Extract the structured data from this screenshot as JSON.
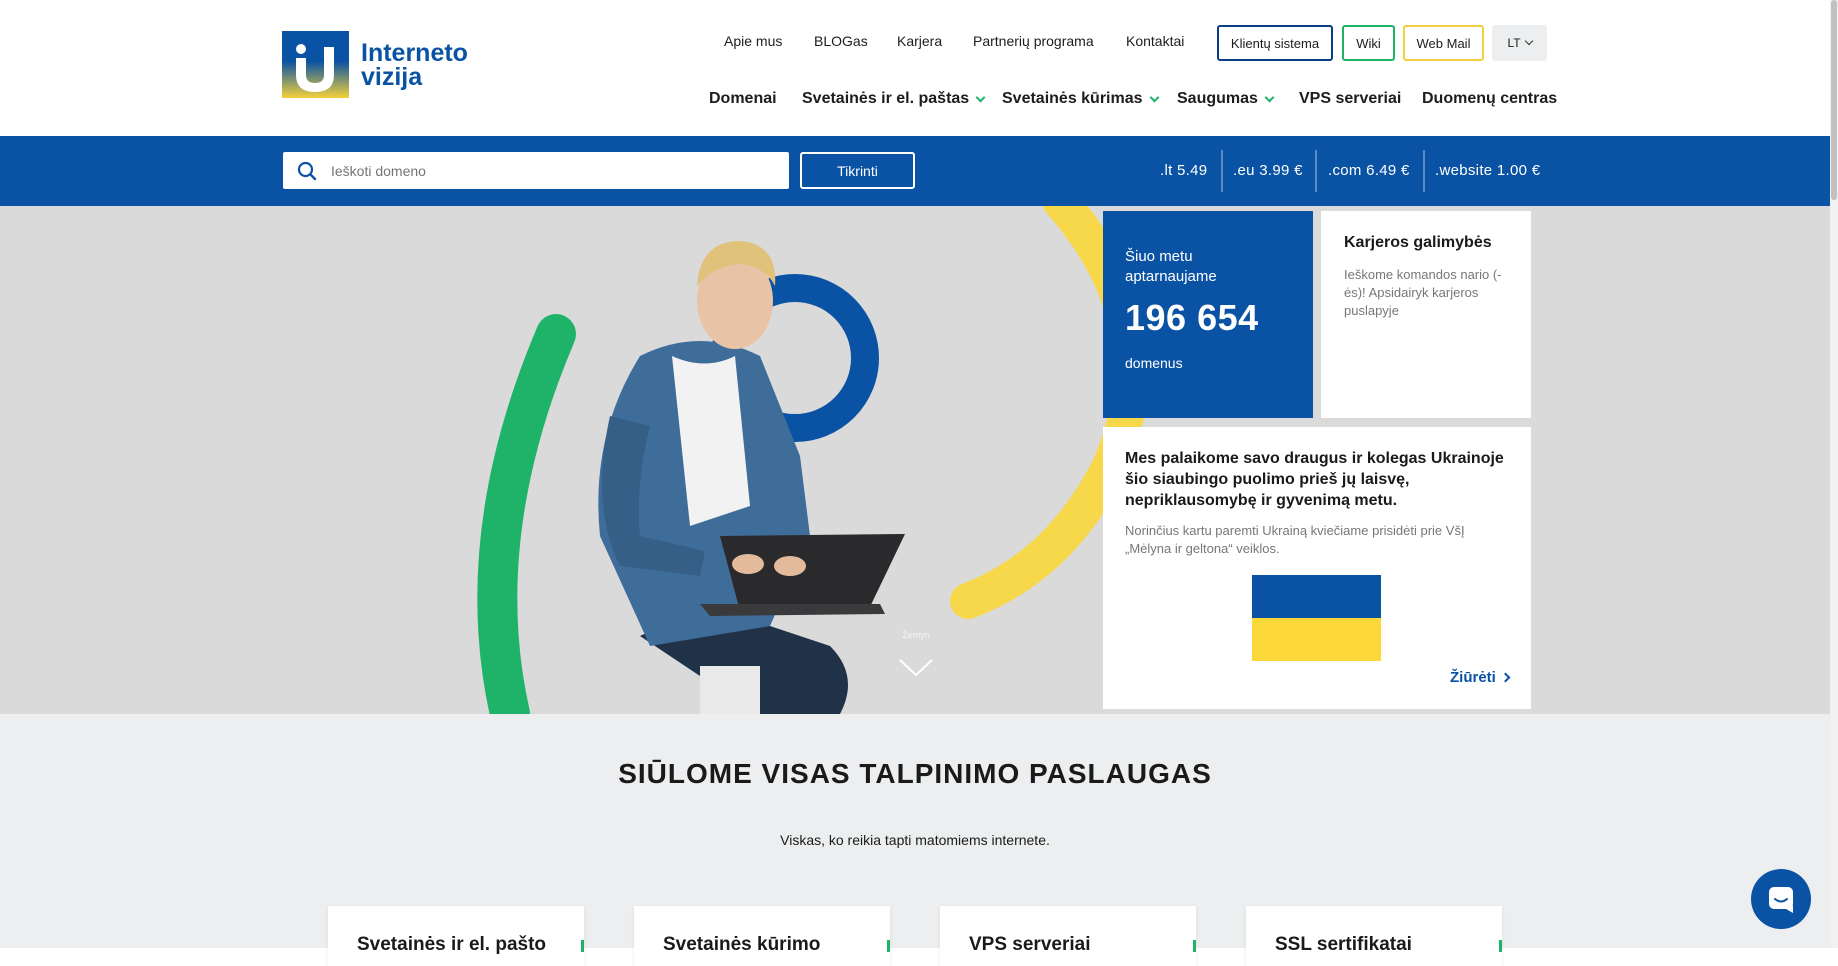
{
  "logo": {
    "line1": "Interneto",
    "line2": "vizija"
  },
  "top_nav": [
    "Apie mus",
    "BLOGas",
    "Karjera",
    "Partnerių programa",
    "Kontaktai"
  ],
  "top_buttons": {
    "clients": "Klientų sistema",
    "wiki": "Wiki",
    "webmail": "Web Mail",
    "lang": "LT"
  },
  "main_nav": [
    {
      "label": "Domenai",
      "dropdown": false
    },
    {
      "label": "Svetainės ir el. paštas",
      "dropdown": true
    },
    {
      "label": "Svetainės kūrimas",
      "dropdown": true
    },
    {
      "label": "Saugumas",
      "dropdown": true
    },
    {
      "label": "VPS serveriai",
      "dropdown": false
    },
    {
      "label": "Duomenų centras",
      "dropdown": false
    }
  ],
  "search": {
    "placeholder": "Ieškoti domeno",
    "button": "Tikrinti"
  },
  "prices": [
    ".lt 5.49",
    ".eu 3.99 €",
    ".com 6.49 €",
    ".website 1.00 €"
  ],
  "hero": {
    "scroll_label": "Žemyn",
    "stats": {
      "line1": "Šiuo metu",
      "line2": "aptarnaujame",
      "number": "196 654",
      "unit": "domenus"
    },
    "career": {
      "title": "Karjeros galimybės",
      "text": "Ieškome komandos nario (-ės)! Apsidairyk karjeros puslapyje"
    },
    "ukraine": {
      "title": "Mes palaikome savo draugus ir kolegas Ukrainoje šio siaubingo puolimo prieš jų laisvę, nepriklausomybę ir gyvenimą metu.",
      "text": "Norinčius kartu paremti Ukrainą kviečiame prisidėti prie VšĮ „Mėlyna ir geltona“ veiklos.",
      "link": "Žiūrėti"
    }
  },
  "services": {
    "title": "SIŪLOME VISAS TALPINIMO PASLAUGAS",
    "subtitle": "Viskas, ko reikia tapti matomiems internete.",
    "cards": [
      "Svetainės ir el. pašto",
      "Svetainės kūrimo",
      "VPS serveriai",
      "SSL sertifikatai"
    ]
  },
  "colors": {
    "brand_blue": "#0a52a3",
    "accent_green": "#1fb36a",
    "accent_yellow": "#f6d84a"
  }
}
